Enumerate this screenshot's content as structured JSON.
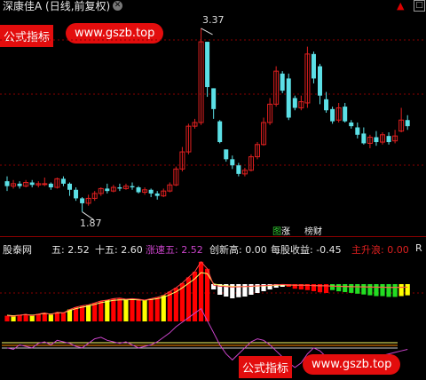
{
  "header": {
    "title": "深康佳A (日线,前复权)",
    "close_glyph": "✕",
    "arrow_glyph": "▲",
    "maximize_glyph": "□"
  },
  "watermark_top": {
    "badge": "公式指标",
    "url": "www.gszb.top"
  },
  "watermark_bottom": {
    "badge": "公式指标",
    "url": "www.gszb.top"
  },
  "price_panel": {
    "high_label": "3.37",
    "low_label": "1.87",
    "tag_zhang": "涨",
    "tag_cai": "财",
    "tag_bang": "榜",
    "tag_icon": "图"
  },
  "indicator_bar": {
    "name": "股泰网",
    "items": [
      {
        "label": "五: 2.52",
        "color": "#e6e6e6"
      },
      {
        "label": "十五: 2.60",
        "color": "#e6e6e6"
      },
      {
        "label": "涨速五: 2.52",
        "color": "#cc44cc"
      },
      {
        "label": "创新高: 0.00",
        "color": "#e6e6e6"
      },
      {
        "label": "每股收益: -0.45",
        "color": "#e6e6e6"
      },
      {
        "label": "主升浪: 0.00",
        "color": "#e02020"
      }
    ],
    "right_mark": "R"
  },
  "chart_data": [
    {
      "type": "candlestick",
      "title": "深康佳A (日线,前复权)",
      "ylim": [
        1.7,
        3.5
      ],
      "annotations": [
        {
          "text": "3.37",
          "value": 3.37
        },
        {
          "text": "1.87",
          "value": 1.87
        }
      ],
      "candles": [
        [
          2.12,
          2.08,
          2.16,
          2.04
        ],
        [
          2.08,
          2.1,
          2.13,
          2.06
        ],
        [
          2.1,
          2.08,
          2.12,
          2.06
        ],
        [
          2.08,
          2.11,
          2.13,
          2.07
        ],
        [
          2.11,
          2.09,
          2.13,
          2.07
        ],
        [
          2.09,
          2.1,
          2.12,
          2.07
        ],
        [
          2.1,
          2.1,
          2.15,
          2.08
        ],
        [
          2.1,
          2.07,
          2.11,
          2.05
        ],
        [
          2.07,
          2.14,
          2.15,
          2.06
        ],
        [
          2.14,
          2.1,
          2.16,
          2.08
        ],
        [
          2.1,
          2.05,
          2.11,
          2.0
        ],
        [
          2.05,
          1.98,
          2.07,
          1.96
        ],
        [
          1.98,
          1.94,
          1.99,
          1.87
        ],
        [
          1.94,
          1.98,
          2.01,
          1.92
        ],
        [
          1.98,
          2.02,
          2.04,
          1.96
        ],
        [
          2.02,
          2.06,
          2.07,
          2.0
        ],
        [
          2.06,
          2.04,
          2.1,
          2.02
        ],
        [
          2.04,
          2.07,
          2.09,
          2.03
        ],
        [
          2.07,
          2.06,
          2.1,
          2.04
        ],
        [
          2.06,
          2.08,
          2.1,
          2.05
        ],
        [
          2.08,
          2.07,
          2.11,
          2.05
        ],
        [
          2.07,
          2.03,
          2.08,
          2.02
        ],
        [
          2.03,
          2.05,
          2.07,
          2.01
        ],
        [
          2.05,
          2.02,
          2.06,
          1.99
        ],
        [
          2.02,
          2.0,
          2.04,
          1.97
        ],
        [
          2.0,
          2.04,
          2.06,
          1.99
        ],
        [
          2.04,
          2.09,
          2.11,
          2.03
        ],
        [
          2.09,
          2.22,
          2.24,
          2.08
        ],
        [
          2.22,
          2.36,
          2.4,
          2.2
        ],
        [
          2.36,
          2.57,
          2.59,
          2.34
        ],
        [
          2.57,
          2.6,
          2.63,
          2.55
        ],
        [
          2.6,
          3.26,
          3.37,
          2.58
        ],
        [
          3.26,
          2.89,
          3.06,
          2.81
        ],
        [
          2.88,
          2.71,
          2.88,
          2.63
        ],
        [
          2.61,
          2.44,
          2.62,
          2.43
        ],
        [
          2.38,
          2.3,
          2.38,
          2.28
        ],
        [
          2.3,
          2.25,
          2.33,
          2.22
        ],
        [
          2.25,
          2.18,
          2.27,
          2.16
        ],
        [
          2.18,
          2.21,
          2.23,
          2.16
        ],
        [
          2.21,
          2.32,
          2.34,
          2.2
        ],
        [
          2.32,
          2.42,
          2.44,
          2.3
        ],
        [
          2.42,
          2.6,
          2.64,
          2.41
        ],
        [
          2.6,
          2.75,
          2.8,
          2.58
        ],
        [
          2.75,
          3.02,
          3.06,
          2.73
        ],
        [
          3.0,
          2.86,
          3.02,
          2.84
        ],
        [
          2.96,
          2.64,
          3.0,
          2.62
        ],
        [
          2.8,
          2.72,
          2.82,
          2.7
        ],
        [
          2.72,
          2.77,
          2.82,
          2.7
        ],
        [
          2.76,
          3.16,
          3.22,
          2.72
        ],
        [
          3.16,
          2.96,
          3.18,
          2.92
        ],
        [
          3.06,
          2.82,
          3.08,
          2.75
        ],
        [
          2.79,
          2.7,
          2.85,
          2.68
        ],
        [
          2.71,
          2.61,
          2.73,
          2.59
        ],
        [
          2.62,
          2.72,
          2.76,
          2.6
        ],
        [
          2.73,
          2.61,
          2.76,
          2.6
        ],
        [
          2.6,
          2.57,
          2.62,
          2.55
        ],
        [
          2.56,
          2.5,
          2.6,
          2.47
        ],
        [
          2.51,
          2.43,
          2.56,
          2.42
        ],
        [
          2.43,
          2.48,
          2.5,
          2.39
        ],
        [
          2.48,
          2.44,
          2.53,
          2.41
        ],
        [
          2.44,
          2.5,
          2.52,
          2.42
        ],
        [
          2.49,
          2.44,
          2.52,
          2.42
        ],
        [
          2.45,
          2.49,
          2.54,
          2.43
        ],
        [
          2.53,
          2.62,
          2.72,
          2.52
        ],
        [
          2.62,
          2.57,
          2.66,
          2.54
        ]
      ]
    },
    {
      "type": "bar",
      "title": "股泰网",
      "series": [
        {
          "name": "五",
          "values": [
            0.2,
            0.18,
            0.22,
            0.25,
            0.2,
            0.26,
            0.3,
            0.24,
            0.32,
            0.3,
            0.42,
            0.5,
            0.55,
            0.58,
            0.65,
            0.72,
            0.75,
            0.8,
            0.82,
            0.78,
            0.8,
            0.78,
            0.75,
            0.8,
            0.85,
            0.92,
            1.05,
            1.18,
            1.35,
            1.55,
            1.75,
            2.1,
            1.85,
            1.2,
            1.05,
            1.0,
            0.95,
            0.98,
            1.0,
            1.05,
            1.1,
            1.15,
            1.2,
            1.25,
            1.3,
            1.28,
            1.22,
            1.2,
            1.18,
            1.15,
            1.12,
            1.1,
            1.05,
            1.02,
            1.0,
            0.98,
            0.96,
            0.94,
            0.92,
            0.9,
            0.9,
            0.88,
            0.88,
            0.9,
            0.92
          ]
        },
        {
          "name": "十五",
          "values": [
            0.22,
            0.2,
            0.22,
            0.24,
            0.22,
            0.25,
            0.28,
            0.26,
            0.3,
            0.3,
            0.38,
            0.45,
            0.5,
            0.54,
            0.6,
            0.66,
            0.7,
            0.74,
            0.76,
            0.76,
            0.77,
            0.76,
            0.75,
            0.77,
            0.8,
            0.85,
            0.94,
            1.04,
            1.18,
            1.34,
            1.5,
            1.72,
            1.68,
            1.38,
            1.22,
            1.12,
            1.04,
            1.0,
            1.0,
            1.02,
            1.06,
            1.1,
            1.14,
            1.18,
            1.22,
            1.22,
            1.2,
            1.19,
            1.17,
            1.15,
            1.13,
            1.11,
            1.08,
            1.05,
            1.02,
            1.0,
            0.98,
            0.96,
            0.94,
            0.92,
            0.92,
            0.9,
            0.9,
            0.91,
            0.92
          ]
        },
        {
          "name": "涨速五",
          "values": [
            0.3,
            0.25,
            0.4,
            0.35,
            0.3,
            0.45,
            0.5,
            0.4,
            0.55,
            0.5,
            0.45,
            0.35,
            0.3,
            0.45,
            0.6,
            0.65,
            0.55,
            0.5,
            0.45,
            0.5,
            0.4,
            0.3,
            0.35,
            0.4,
            0.5,
            0.65,
            0.8,
            1.0,
            1.15,
            1.3,
            1.45,
            1.6,
            1.2,
            0.8,
            0.4,
            0.1,
            -0.1,
            0.1,
            0.3,
            0.5,
            0.6,
            0.55,
            0.4,
            0.2,
            0.0,
            -0.2,
            -0.35,
            -0.2,
            0.1,
            0.3,
            0.2,
            0.0,
            -0.2,
            -0.35,
            -0.3,
            -0.1,
            0.0,
            0.05,
            -0.05,
            0.0,
            0.05,
            0.1,
            0.15,
            0.2,
            0.25
          ]
        }
      ]
    }
  ],
  "colors": {
    "up": "#e02020",
    "down": "#5ce0e6",
    "ma5": "#ff0000",
    "ma15": "#ffff00",
    "speed": "#cc44cc",
    "separator": "#8a0000"
  }
}
